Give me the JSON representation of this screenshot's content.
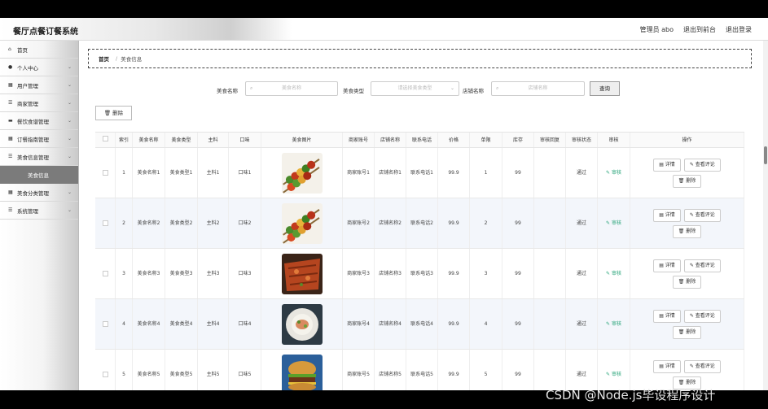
{
  "header": {
    "brand": "餐厅点餐订餐系统",
    "admin": "管理员 abo",
    "front": "退出到前台",
    "logout": "退出登录"
  },
  "sidebar": {
    "items": [
      {
        "icon": "home-icon",
        "label": "首页"
      },
      {
        "icon": "user-icon",
        "label": "个人中心"
      },
      {
        "icon": "grid-icon",
        "label": "用户管理"
      },
      {
        "icon": "list-icon",
        "label": "商家管理"
      },
      {
        "icon": "folder-icon",
        "label": "餐饮食谱管理"
      },
      {
        "icon": "grid-icon",
        "label": "订餐指南管理"
      },
      {
        "icon": "list-icon",
        "label": "美食信息管理"
      }
    ],
    "active_sub": "美食信息",
    "items_after": [
      {
        "icon": "grid-icon",
        "label": "美食分类管理"
      },
      {
        "icon": "list-icon",
        "label": "系统管理"
      }
    ]
  },
  "breadcrumb": {
    "home": "首页",
    "sep": "/",
    "current": "美食信息"
  },
  "filter": {
    "name_label": "美食名称",
    "name_placeholder": "美食名称",
    "type_label": "美食类型",
    "type_placeholder": "请选择美食类型",
    "shop_label": "店铺名称",
    "shop_placeholder": "店铺名称",
    "query_label": "查询"
  },
  "delete_label": "删除",
  "columns": [
    "",
    "索引",
    "美食名称",
    "美食类型",
    "主料",
    "口味",
    "美食图片",
    "商家账号",
    "店铺名称",
    "联系电话",
    "价格",
    "单限",
    "库存",
    "审核回复",
    "审核状态",
    "审核",
    "操作"
  ],
  "rows": [
    {
      "index": "1",
      "name": "美食名称1",
      "type": "美食类型1",
      "main": "主料1",
      "taste": "口味1",
      "img": "skewers",
      "account": "商家账号1",
      "shop": "店铺名称1",
      "phone": "联系电话1",
      "price": "99.9",
      "limit": "1",
      "stock": "99",
      "reply": "",
      "status": "通过",
      "audit": "审核"
    },
    {
      "index": "2",
      "name": "美食名称2",
      "type": "美食类型2",
      "main": "主料2",
      "taste": "口味2",
      "img": "skewers",
      "account": "商家账号2",
      "shop": "店铺名称2",
      "phone": "联系电话2",
      "price": "99.9",
      "limit": "2",
      "stock": "99",
      "reply": "",
      "status": "通过",
      "audit": "审核"
    },
    {
      "index": "3",
      "name": "美食名称3",
      "type": "美食类型3",
      "main": "主料3",
      "taste": "口味3",
      "img": "pizza",
      "account": "商家账号3",
      "shop": "店铺名称3",
      "phone": "联系电话3",
      "price": "99.9",
      "limit": "3",
      "stock": "99",
      "reply": "",
      "status": "通过",
      "audit": "审核"
    },
    {
      "index": "4",
      "name": "美食名称4",
      "type": "美食类型4",
      "main": "主料4",
      "taste": "口味4",
      "img": "plate",
      "account": "商家账号4",
      "shop": "店铺名称4",
      "phone": "联系电话4",
      "price": "99.9",
      "limit": "4",
      "stock": "99",
      "reply": "",
      "status": "通过",
      "audit": "审核"
    },
    {
      "index": "5",
      "name": "美食名称5",
      "type": "美食类型5",
      "main": "主料5",
      "taste": "口味5",
      "img": "burger",
      "account": "商家账号5",
      "shop": "店铺名称5",
      "phone": "联系电话5",
      "price": "99.9",
      "limit": "5",
      "stock": "99",
      "reply": "",
      "status": "通过",
      "audit": "审核"
    }
  ],
  "ops": {
    "detail": "详情",
    "review": "查看评论",
    "delete": "删除"
  },
  "watermark": "CSDN @Node.js毕设程序设计"
}
